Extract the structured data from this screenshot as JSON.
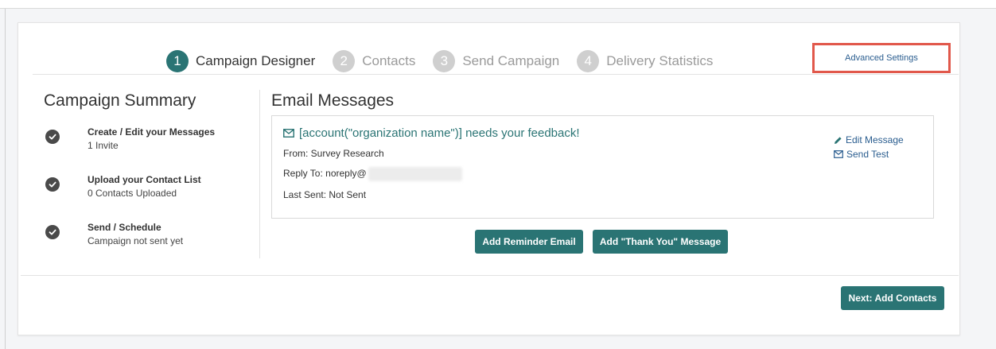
{
  "steps": [
    {
      "num": "1",
      "label": "Campaign Designer"
    },
    {
      "num": "2",
      "label": "Contacts"
    },
    {
      "num": "3",
      "label": "Send Campaign"
    },
    {
      "num": "4",
      "label": "Delivery Statistics"
    }
  ],
  "advanced_settings": "Advanced Settings",
  "summary": {
    "title": "Campaign Summary",
    "items": [
      {
        "title": "Create / Edit your Messages",
        "sub": "1 Invite"
      },
      {
        "title": "Upload your Contact List",
        "sub": "0 Contacts Uploaded"
      },
      {
        "title": "Send / Schedule",
        "sub": "Campaign not sent yet"
      }
    ]
  },
  "email": {
    "title": "Email Messages",
    "subject": "[account(\"organization name\")] needs your feedback!",
    "from": "From: Survey Research",
    "reply_to": "Reply To: noreply@",
    "last_sent": "Last Sent: Not Sent",
    "edit_message": "Edit Message",
    "send_test": "Send Test"
  },
  "buttons": {
    "add_reminder": "Add Reminder Email",
    "add_thank_you": "Add \"Thank You\" Message",
    "next": "Next: Add Contacts"
  },
  "colors": {
    "accent": "#2a7474",
    "highlight": "#e1584b",
    "link": "#2a5d8f"
  }
}
